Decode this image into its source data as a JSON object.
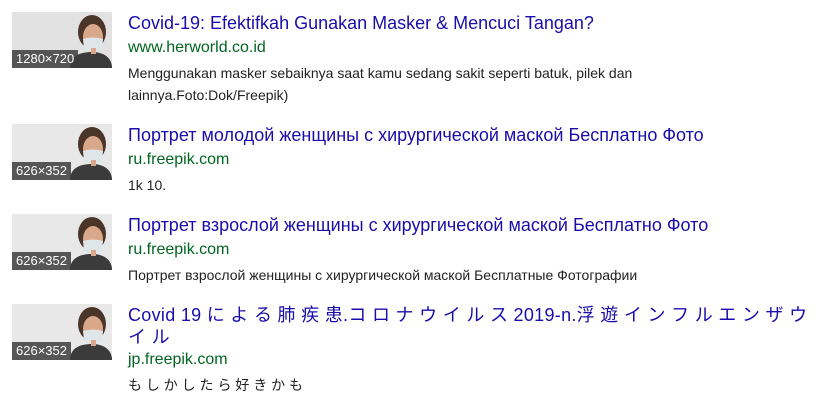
{
  "results": [
    {
      "dims": "1280×720",
      "title": "Covid-19: Efektifkah Gunakan Masker & Mencuci Tangan?",
      "url": "www.herworld.co.id",
      "desc": "Menggunakan masker sebaiknya saat kamu sedang sakit seperti batuk, pilek dan lainnya.Foto:Dok/Freepik)"
    },
    {
      "dims": "626×352",
      "title": "Портрет молодой женщины с хирургической маской Бесплатно Фото",
      "url": "ru.freepik.com",
      "desc": "1k 10."
    },
    {
      "dims": "626×352",
      "title": "Портрет взрослой женщины с хирургической маской Бесплатно Фото",
      "url": "ru.freepik.com",
      "desc": "Портрет взрослой женщины с хирургической маской Бесплатные Фотографии"
    },
    {
      "dims": "626×352",
      "title": "Covid 19 に よ る 肺 疾 患.コ ロ ナ ウ イ ル ス 2019-n.浮 遊 イ ン フ ル エ ン ザ ウ イ ル",
      "url": "jp.freepik.com",
      "desc": "も し か し た ら 好 き か も"
    }
  ],
  "colors": {
    "title": "#1a0dab",
    "url": "#006621",
    "text": "#222222"
  }
}
